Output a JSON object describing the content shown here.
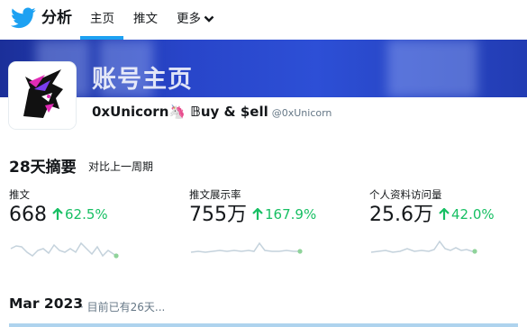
{
  "nav": {
    "brand": "分析",
    "tabs": [
      {
        "label": "主页",
        "active": true
      },
      {
        "label": "推文",
        "active": false
      },
      {
        "label": "更多",
        "active": false
      }
    ]
  },
  "profile": {
    "banner_title": "账号主页",
    "display_name": "0xUnicorn🦄 𝔹uy & $ell",
    "username": "@0xUnicorn"
  },
  "summary": {
    "title": "28天摘要",
    "subtitle": "对比上一周期",
    "metrics": [
      {
        "label": "推文",
        "value": "668",
        "change": "62.5%"
      },
      {
        "label": "推文展示率",
        "value": "755万",
        "change": "167.9%"
      },
      {
        "label": "个人资料访问量",
        "value": "25.6万",
        "change": "42.0%"
      }
    ]
  },
  "month": {
    "title": "Mar 2023",
    "subtitle": "目前已有26天..."
  },
  "colors": {
    "accent": "#1da1f2",
    "positive": "#17bf63",
    "spark_line": "#c4d2dc",
    "spark_dot": "#8fd39a"
  }
}
